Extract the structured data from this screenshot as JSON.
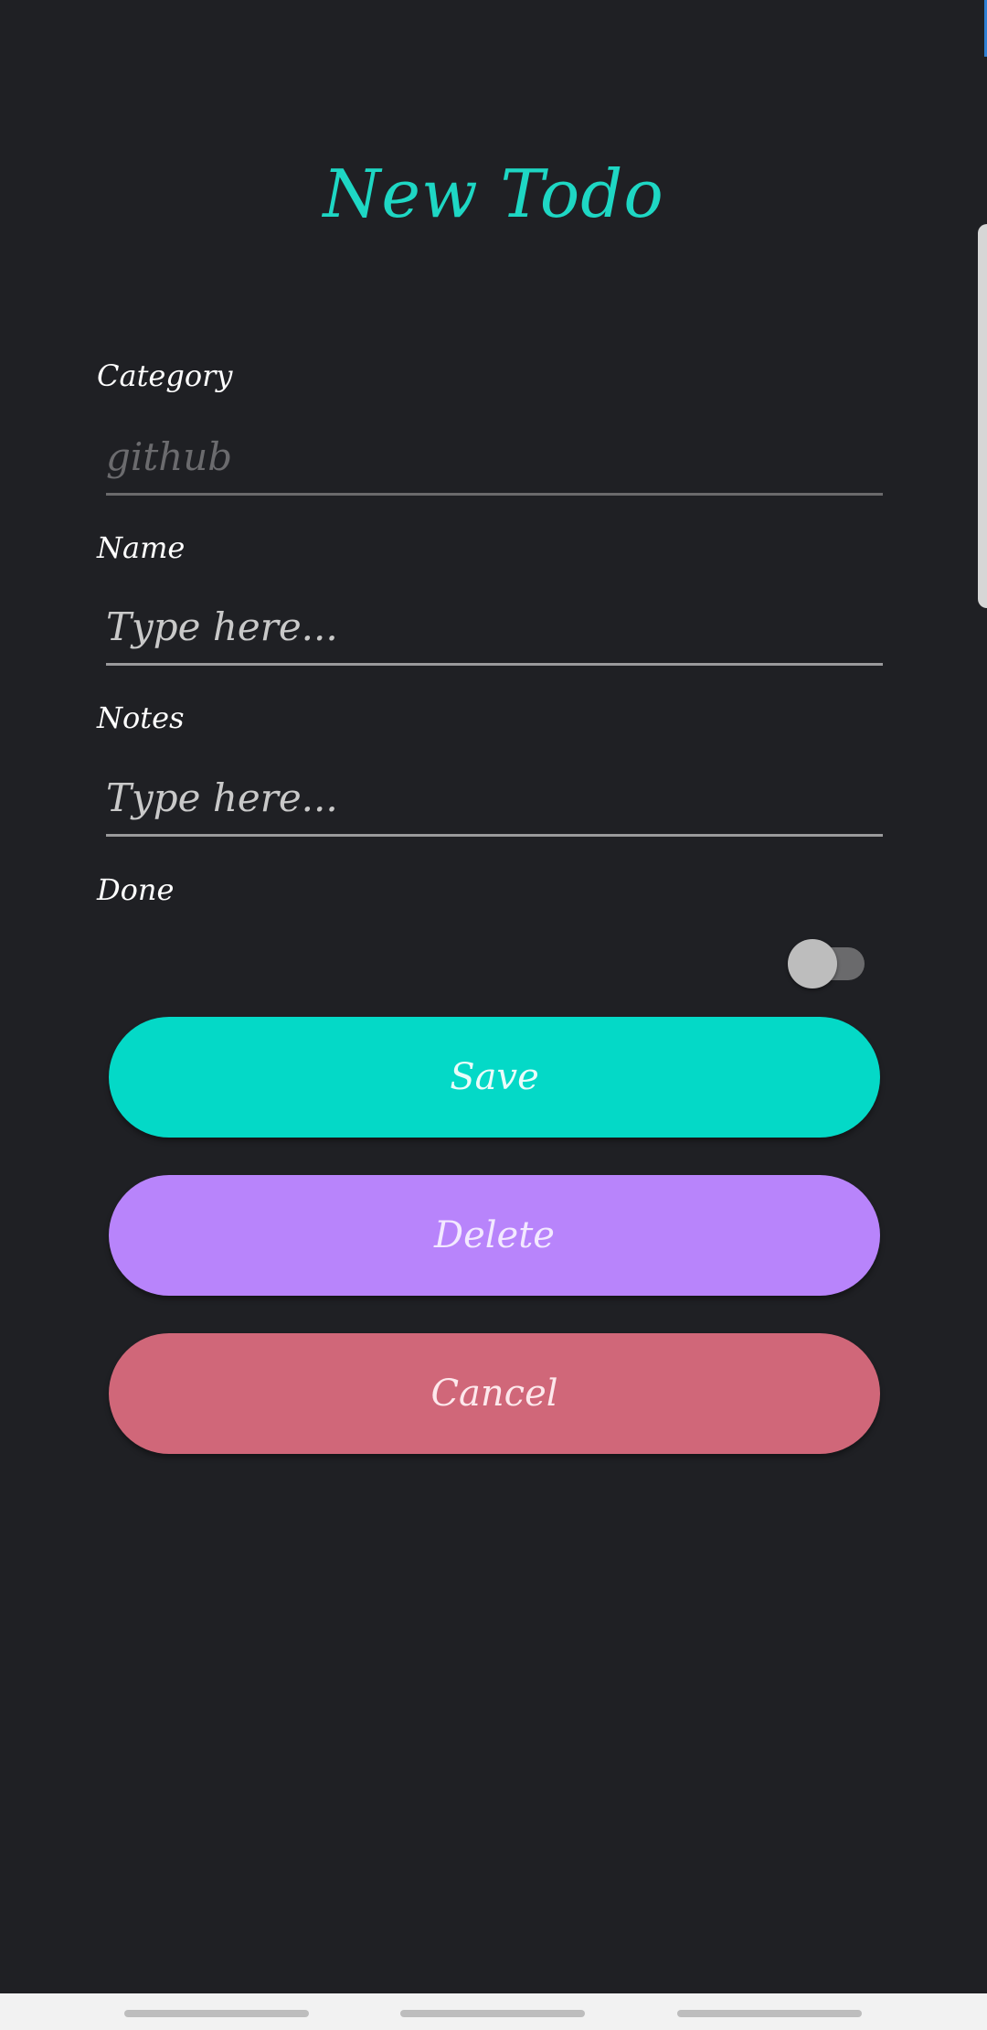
{
  "header": {
    "title": "New Todo"
  },
  "form": {
    "category": {
      "label": "Category",
      "placeholder": "github",
      "value": ""
    },
    "name": {
      "label": "Name",
      "placeholder": "Type here...",
      "value": ""
    },
    "notes": {
      "label": "Notes",
      "placeholder": "Type here...",
      "value": ""
    },
    "done": {
      "label": "Done",
      "checked": false
    }
  },
  "buttons": {
    "save_label": "Save",
    "delete_label": "Delete",
    "cancel_label": "Cancel"
  },
  "colors": {
    "background": "#1f2024",
    "accent": "#1ed7c4",
    "save": "#04d9c7",
    "delete": "#b884fb",
    "cancel": "#d06779"
  },
  "icons": {
    "nav_handles": [
      "nav-handle-icon",
      "nav-handle-icon",
      "nav-handle-icon"
    ]
  }
}
